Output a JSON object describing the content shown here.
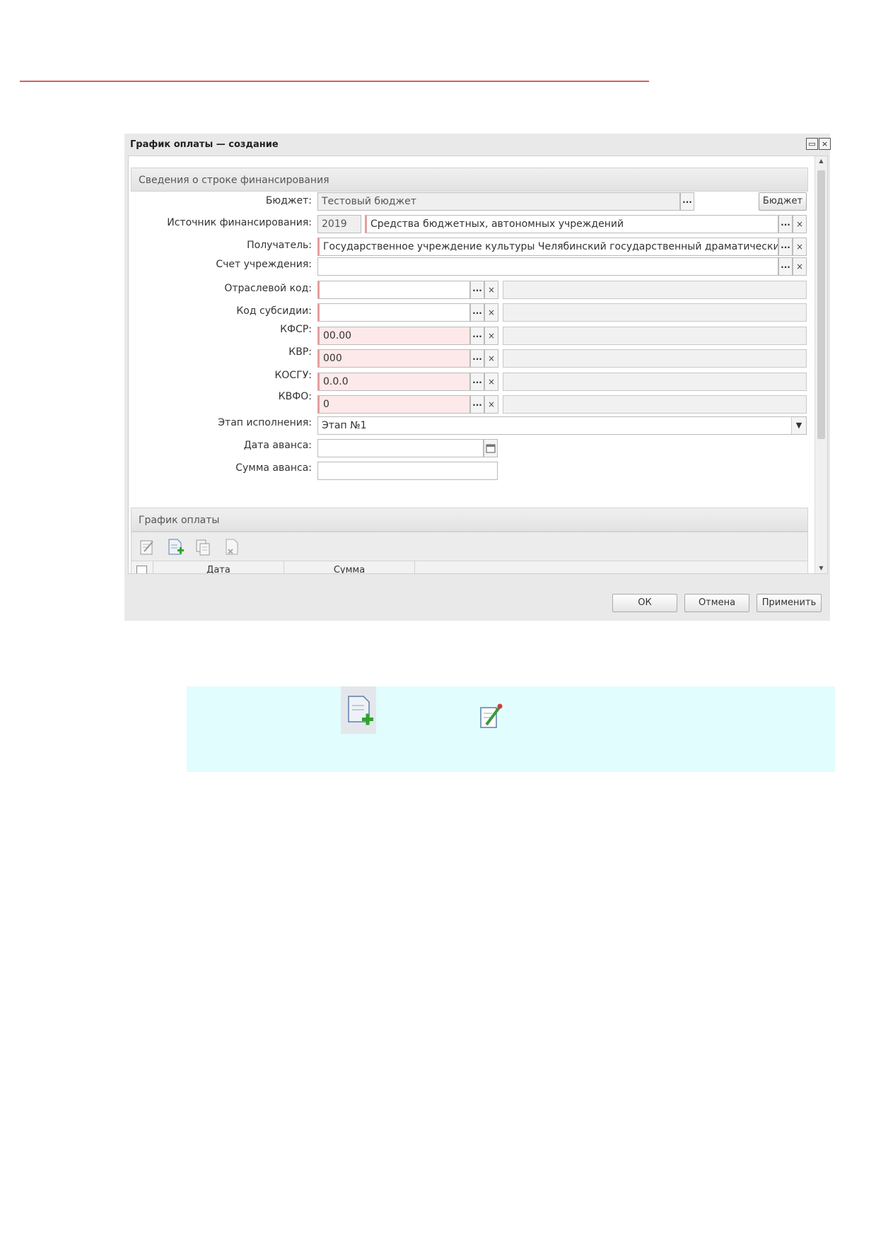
{
  "dialog": {
    "title": "График оплаты — создание",
    "section1": "Сведения о строке финансирования",
    "fields": {
      "budget": {
        "label": "Бюджет:",
        "value": "Тестовый бюджет",
        "button": "Бюджет"
      },
      "source": {
        "label": "Источник финансирования:",
        "year": "2019",
        "value": "Средства бюджетных, автономных учреждений"
      },
      "recipient": {
        "label": "Получатель:",
        "value": "Государственное учреждение культуры Челябинский государственный драматический Каме"
      },
      "account": {
        "label": "Счет учреждения:",
        "value": ""
      },
      "branch_code": {
        "label": "Отраслевой код:",
        "value": ""
      },
      "subsidy_code": {
        "label": "Код субсидии:",
        "value": ""
      },
      "kfsr": {
        "label": "КФСР:",
        "value": "00.00"
      },
      "kvr": {
        "label": "КВР:",
        "value": "000"
      },
      "kosgu": {
        "label": "КОСГУ:",
        "value": "0.0.0"
      },
      "kvfo": {
        "label": "КВФО:",
        "value": "0"
      },
      "stage": {
        "label": "Этап исполнения:",
        "value": "Этап №1"
      },
      "advance_date": {
        "label": "Дата аванса:",
        "value": ""
      },
      "advance_sum": {
        "label": "Сумма аванса:",
        "value": ""
      }
    },
    "section2": "График оплаты",
    "grid": {
      "columns": [
        "Дата",
        "Сумма"
      ]
    },
    "buttons": {
      "ok": "ОК",
      "cancel": "Отмена",
      "apply": "Применить"
    },
    "dots_label": "...",
    "clear_label": "×"
  },
  "icons": {
    "toolbar": [
      "edit-icon",
      "add-document-icon",
      "copy-document-icon",
      "delete-document-icon"
    ],
    "note": [
      "add-document-icon",
      "edit-icon"
    ]
  },
  "colors": {
    "accent_line": "#e05a5a",
    "required_bg": "#fde9e9",
    "note_bg": "#e1fdfd"
  }
}
